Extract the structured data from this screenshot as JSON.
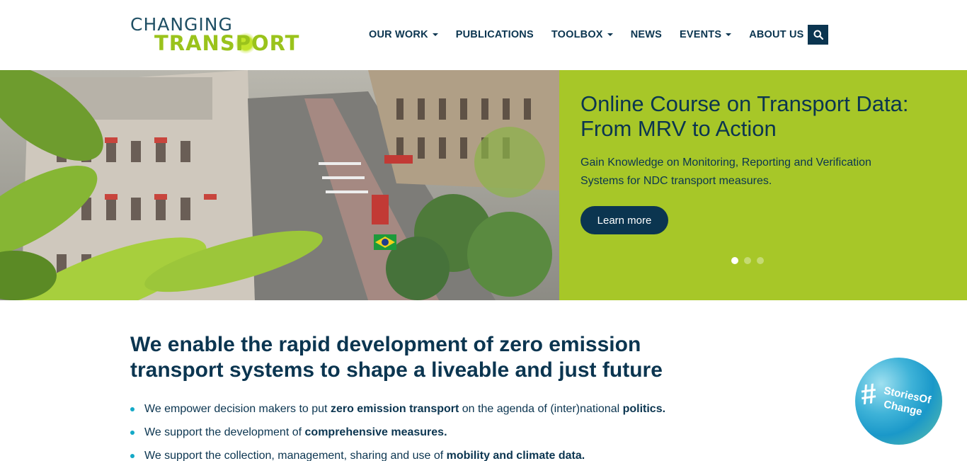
{
  "logo": {
    "line1": "CHANGING",
    "line2": "TRANSPORT"
  },
  "nav": {
    "items": [
      {
        "label": "OUR WORK",
        "dropdown": true
      },
      {
        "label": "PUBLICATIONS",
        "dropdown": false
      },
      {
        "label": "TOOLBOX",
        "dropdown": true
      },
      {
        "label": "NEWS",
        "dropdown": false
      },
      {
        "label": "EVENTS",
        "dropdown": true
      },
      {
        "label": "ABOUT US",
        "dropdown": true
      }
    ],
    "search_icon": "search-icon"
  },
  "hero": {
    "title": "Online Course on Transport Data: From MRV to Action",
    "text": "Gain Knowledge on Monitoring, Reporting and Verification Systems for NDC transport measures.",
    "button_label": "Learn more",
    "slides_total": 3,
    "active_slide": 1,
    "panel_color": "#a7c728"
  },
  "main": {
    "headline": "We enable the rapid development of zero emission transport systems to shape a liveable and just future",
    "bullets": [
      {
        "pre": "We empower decision makers to put ",
        "bold1": "zero emission transport",
        "mid": " on the agenda of (inter)national ",
        "bold2": "politics."
      },
      {
        "pre": "We support the development of ",
        "bold1": "comprehensive measures.",
        "mid": "",
        "bold2": ""
      },
      {
        "pre": "We support the collection, management, sharing and use of ",
        "bold1": "mobility and climate data.",
        "mid": "",
        "bold2": ""
      }
    ]
  },
  "badge": {
    "hash": "#",
    "line1": "StoriesOf",
    "line2": "Change"
  },
  "colors": {
    "navy": "#0b3550",
    "green": "#a7c728",
    "bullet": "#14a9c7"
  }
}
